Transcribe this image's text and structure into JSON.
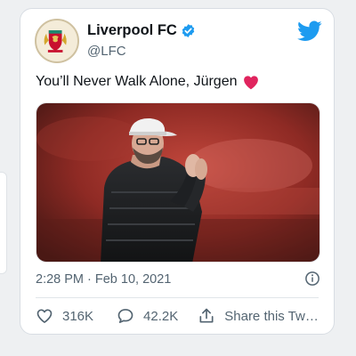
{
  "tweet": {
    "display_name": "Liverpool FC",
    "handle": "@LFC",
    "text": "You’ll Never Walk Alone, Jürgen",
    "timestamp": "2:28 PM · Feb 10, 2021",
    "likes": "316K",
    "replies": "42.2K",
    "share_label": "Share this Tw…"
  },
  "colors": {
    "heart": "#e0245e",
    "twitter_blue": "#1d9bf0",
    "verified": "#1d9bf0",
    "text_secondary": "#536471"
  },
  "icons": {
    "verified": "verified-badge-icon",
    "twitter": "twitter-bird-icon",
    "heart": "red-heart-emoji",
    "info": "info-circle-icon",
    "like": "heart-outline-icon",
    "reply": "speech-bubble-icon",
    "share": "share-upload-icon"
  }
}
